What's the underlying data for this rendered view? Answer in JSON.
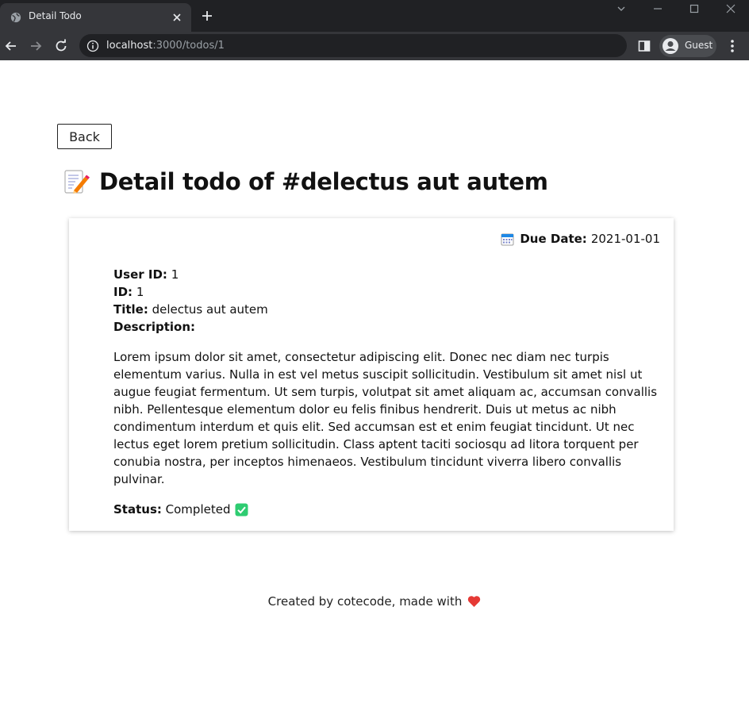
{
  "browser": {
    "tab_title": "Detail Todo",
    "url_host": "localhost",
    "url_path": ":3000/todos/1",
    "profile_label": "Guest"
  },
  "page": {
    "back_label": "Back",
    "heading": "Detail todo of #delectus aut autem",
    "heading_icon": "memo-icon"
  },
  "todo": {
    "due_label": "Due Date:",
    "due_value": "2021-01-01",
    "user_id_label": "User ID:",
    "user_id_value": "1",
    "id_label": "ID:",
    "id_value": "1",
    "title_label": "Title:",
    "title_value": "delectus aut autem",
    "description_label": "Description:",
    "description_text": "Lorem ipsum dolor sit amet, consectetur adipiscing elit. Donec nec diam nec turpis elementum varius. Nulla in est vel metus suscipit sollicitudin. Vestibulum sit amet nisl ut augue feugiat fermentum. Ut sem turpis, volutpat sit amet aliquam ac, accumsan convallis nibh. Pellentesque elementum dolor eu felis finibus hendrerit. Duis ut metus ac nibh condimentum interdum et quis elit. Sed accumsan est et enim feugiat tincidunt. Ut nec lectus eget lorem pretium sollicitudin. Class aptent taciti sociosqu ad litora torquent per conubia nostra, per inceptos himenaeos. Vestibulum tincidunt viverra libero convallis pulvinar.",
    "status_label": "Status:",
    "status_value": "Completed"
  },
  "footer": {
    "text": "Created by cotecode, made with"
  },
  "colors": {
    "chrome_dark": "#202124",
    "chrome_tab": "#35363a",
    "check_green": "#2ecc71",
    "heart_red": "#e53935"
  }
}
